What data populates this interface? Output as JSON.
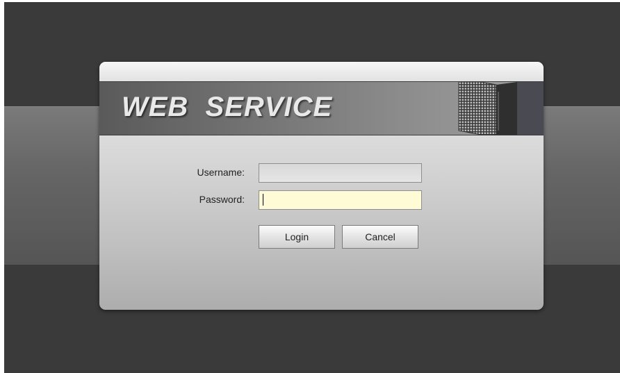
{
  "banner": {
    "title": "WEB  SERVICE",
    "server_image": "server-rack-icon"
  },
  "form": {
    "username_label": "Username:",
    "username_value": "",
    "password_label": "Password:",
    "password_value": "",
    "login_label": "Login",
    "cancel_label": "Cancel"
  },
  "colors": {
    "background": "#3a3a3a",
    "password_field_bg": "#fffbd6"
  }
}
